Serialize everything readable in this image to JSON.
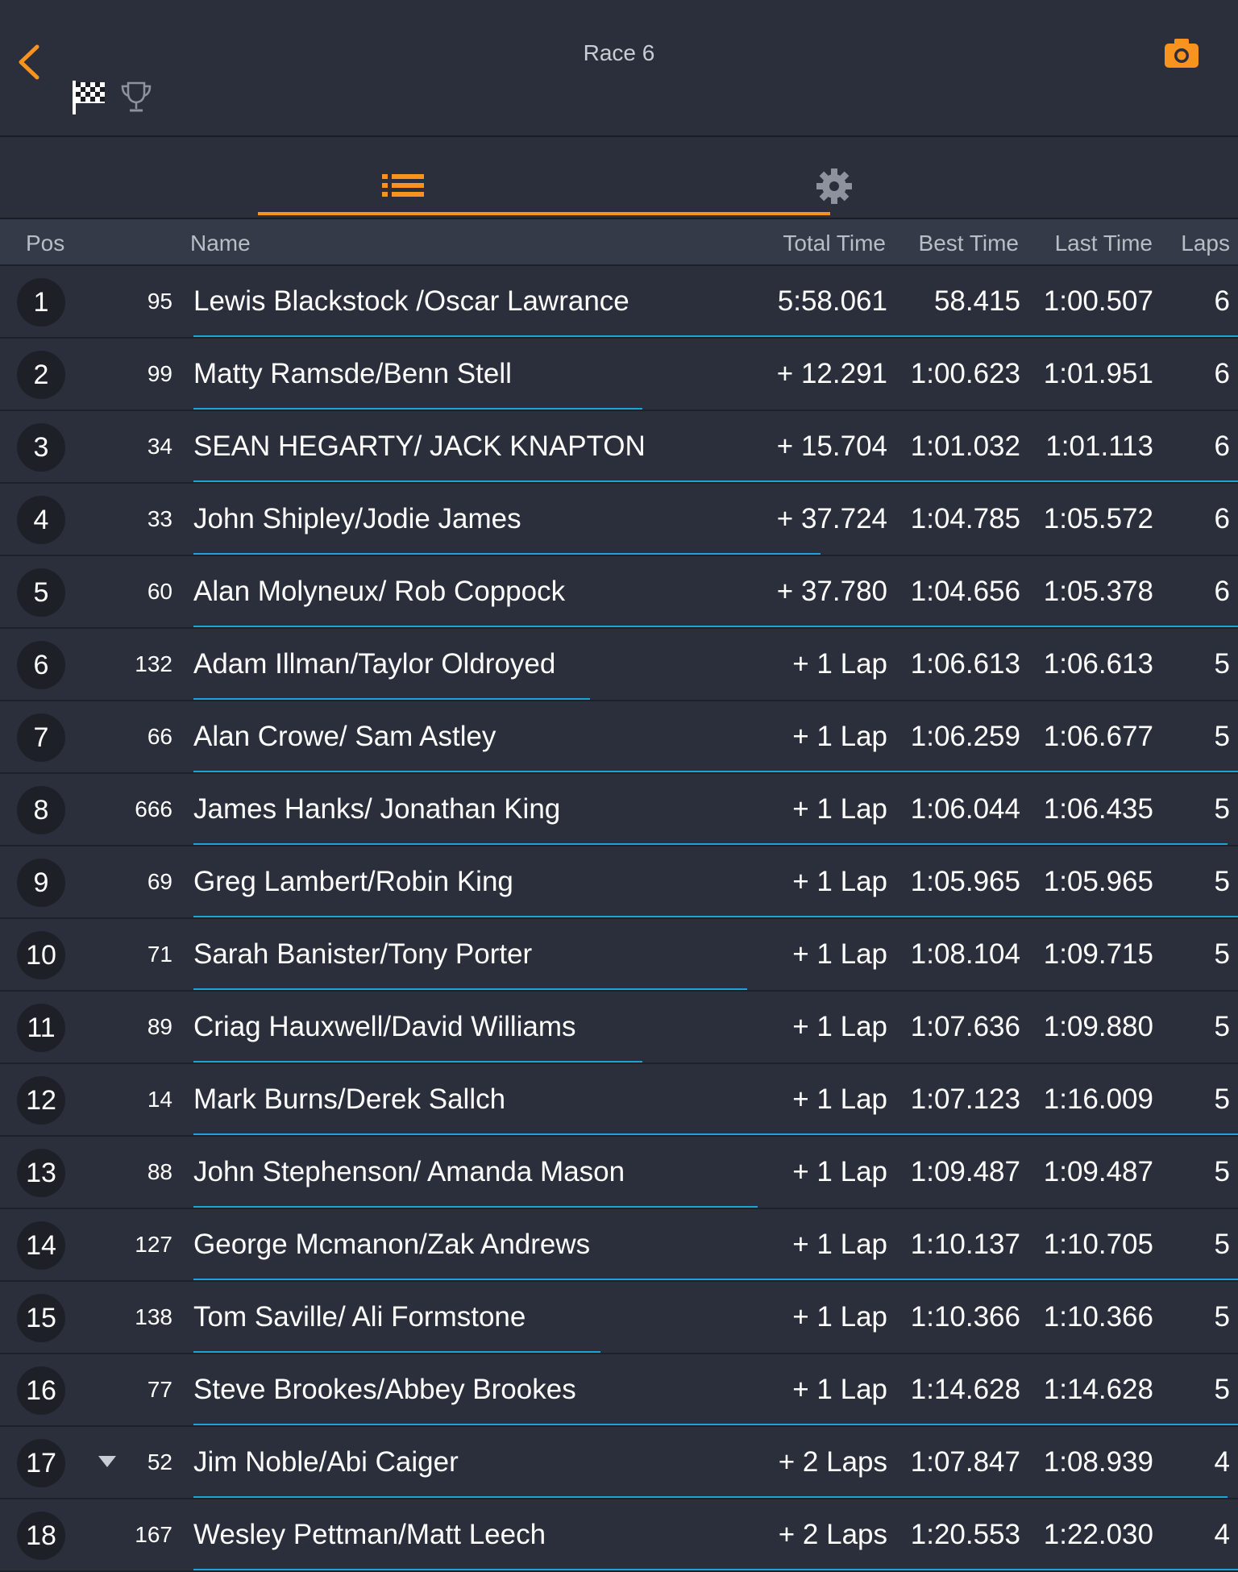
{
  "header": {
    "title": "Race 6",
    "back_icon": "chevron-left-icon",
    "flag_icon": "checkered-flag-icon",
    "trophy_icon": "trophy-icon",
    "camera_icon": "camera-icon"
  },
  "tabs": {
    "list_icon": "list-icon",
    "settings_icon": "gear-icon",
    "active": "list"
  },
  "colors": {
    "accent": "#f7931e",
    "progress": "#1ea3d6",
    "background": "#2a2f3b",
    "header_row": "#343a47",
    "circle": "#1d2027"
  },
  "columns": {
    "pos": "Pos",
    "name": "Name",
    "total": "Total Time",
    "best": "Best Time",
    "last": "Last Time",
    "laps": "Laps"
  },
  "rows": [
    {
      "pos": "1",
      "num": "95",
      "name": "Lewis Blackstock /Oscar Lawrance",
      "total": "5:58.061",
      "best": "58.415",
      "last": "1:00.507",
      "laps": "6",
      "progress": 1.0,
      "arrow": false
    },
    {
      "pos": "2",
      "num": "99",
      "name": "Matty Ramsde/Benn Stell",
      "total": "+ 12.291",
      "best": "1:00.623",
      "last": "1:01.951",
      "laps": "6",
      "progress": 0.43,
      "arrow": false
    },
    {
      "pos": "3",
      "num": "34",
      "name": "SEAN HEGARTY/ JACK KNAPTON",
      "total": "+ 15.704",
      "best": "1:01.032",
      "last": "1:01.113",
      "laps": "6",
      "progress": 1.0,
      "arrow": false
    },
    {
      "pos": "4",
      "num": "33",
      "name": "John Shipley/Jodie James",
      "total": "+ 37.724",
      "best": "1:04.785",
      "last": "1:05.572",
      "laps": "6",
      "progress": 0.6,
      "arrow": false
    },
    {
      "pos": "5",
      "num": "60",
      "name": "Alan Molyneux/ Rob Coppock",
      "total": "+ 37.780",
      "best": "1:04.656",
      "last": "1:05.378",
      "laps": "6",
      "progress": 1.0,
      "arrow": false
    },
    {
      "pos": "6",
      "num": "132",
      "name": "Adam Illman/Taylor Oldroyed",
      "total": "+ 1 Lap",
      "best": "1:06.613",
      "last": "1:06.613",
      "laps": "5",
      "progress": 0.38,
      "arrow": false
    },
    {
      "pos": "7",
      "num": "66",
      "name": "Alan Crowe/ Sam Astley",
      "total": "+ 1 Lap",
      "best": "1:06.259",
      "last": "1:06.677",
      "laps": "5",
      "progress": 1.0,
      "arrow": false
    },
    {
      "pos": "8",
      "num": "666",
      "name": "James Hanks/ Jonathan King",
      "total": "+ 1 Lap",
      "best": "1:06.044",
      "last": "1:06.435",
      "laps": "5",
      "progress": 0.99,
      "arrow": false
    },
    {
      "pos": "9",
      "num": "69",
      "name": "Greg Lambert/Robin King",
      "total": "+ 1 Lap",
      "best": "1:05.965",
      "last": "1:05.965",
      "laps": "5",
      "progress": 1.0,
      "arrow": false
    },
    {
      "pos": "10",
      "num": "71",
      "name": "Sarah Banister/Tony Porter",
      "total": "+ 1 Lap",
      "best": "1:08.104",
      "last": "1:09.715",
      "laps": "5",
      "progress": 0.53,
      "arrow": false
    },
    {
      "pos": "11",
      "num": "89",
      "name": "Criag Hauxwell/David Williams",
      "total": "+ 1 Lap",
      "best": "1:07.636",
      "last": "1:09.880",
      "laps": "5",
      "progress": 0.43,
      "arrow": false
    },
    {
      "pos": "12",
      "num": "14",
      "name": "Mark Burns/Derek Sallch",
      "total": "+ 1 Lap",
      "best": "1:07.123",
      "last": "1:16.009",
      "laps": "5",
      "progress": 1.0,
      "arrow": false
    },
    {
      "pos": "13",
      "num": "88",
      "name": "John Stephenson/ Amanda Mason",
      "total": "+ 1 Lap",
      "best": "1:09.487",
      "last": "1:09.487",
      "laps": "5",
      "progress": 0.54,
      "arrow": false
    },
    {
      "pos": "14",
      "num": "127",
      "name": "George Mcmanon/Zak Andrews",
      "total": "+ 1 Lap",
      "best": "1:10.137",
      "last": "1:10.705",
      "laps": "5",
      "progress": 1.0,
      "arrow": false
    },
    {
      "pos": "15",
      "num": "138",
      "name": "Tom Saville/ Ali Formstone",
      "total": "+ 1 Lap",
      "best": "1:10.366",
      "last": "1:10.366",
      "laps": "5",
      "progress": 0.39,
      "arrow": false
    },
    {
      "pos": "16",
      "num": "77",
      "name": "Steve Brookes/Abbey Brookes",
      "total": "+ 1 Lap",
      "best": "1:14.628",
      "last": "1:14.628",
      "laps": "5",
      "progress": 1.0,
      "arrow": false
    },
    {
      "pos": "17",
      "num": "52",
      "name": "Jim Noble/Abi Caiger",
      "total": "+ 2 Laps",
      "best": "1:07.847",
      "last": "1:08.939",
      "laps": "4",
      "progress": 0.99,
      "arrow": true
    },
    {
      "pos": "18",
      "num": "167",
      "name": "Wesley Pettman/Matt Leech",
      "total": "+ 2 Laps",
      "best": "1:20.553",
      "last": "1:22.030",
      "laps": "4",
      "progress": 1.0,
      "arrow": false
    }
  ]
}
